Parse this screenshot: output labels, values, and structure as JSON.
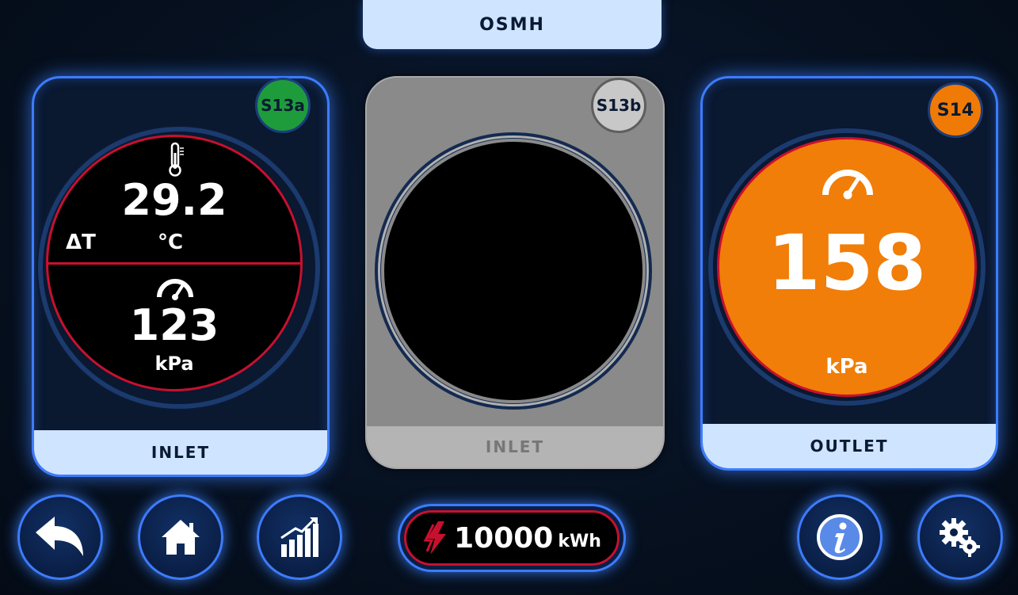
{
  "header": {
    "title": "OSMH"
  },
  "sensors": {
    "left": {
      "badge": "S13a",
      "badge_color": "#1e9c3c",
      "temperature": {
        "value": "29.2",
        "unit": "°C",
        "label": "ΔT",
        "icon": "thermometer-icon"
      },
      "pressure": {
        "value": "123",
        "unit": "kPa",
        "icon": "gauge-icon"
      },
      "label": "INLET"
    },
    "middle": {
      "badge": "S13b",
      "badge_color": "#c8c8c8",
      "label": "INLET",
      "state": "disabled"
    },
    "right": {
      "badge": "S14",
      "badge_color": "#f07a06",
      "pressure": {
        "value": "158",
        "unit": "kPa",
        "icon": "gauge-icon"
      },
      "label": "OUTLET"
    }
  },
  "energy": {
    "value": "10000",
    "unit": "kWh",
    "icon": "lightning-icon"
  },
  "nav_buttons": [
    {
      "name": "back",
      "icon": "back-arrow-icon"
    },
    {
      "name": "home",
      "icon": "home-icon"
    },
    {
      "name": "chart",
      "icon": "bar-chart-icon"
    },
    {
      "name": "info",
      "icon": "info-icon"
    },
    {
      "name": "settings",
      "icon": "gears-icon"
    }
  ],
  "colors": {
    "accent_blue": "#3d7cff",
    "alarm_red": "#c8102e",
    "status_green": "#1e9c3c",
    "status_orange": "#f07a06",
    "label_bg": "#cfe4ff"
  }
}
